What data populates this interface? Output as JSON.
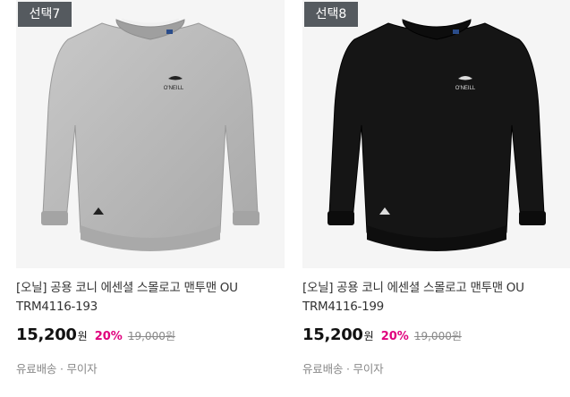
{
  "products": [
    {
      "badge": "선택7",
      "name_line1": "[오닐] 공용 코니 에센셜 스몰로고 맨투맨 OU",
      "name_line2": "TRM4116-193",
      "price": "15,200",
      "currency": "원",
      "discount": "20%",
      "original_price": "19,000원",
      "shipping": "유료배송 · 무이자",
      "color": "#b9b9b9",
      "logo_text": "O'NEILL"
    },
    {
      "badge": "선택8",
      "name_line1": "[오닐] 공용 코니 에센셜 스몰로고 맨투맨 OU",
      "name_line2": "TRM4116-199",
      "price": "15,200",
      "currency": "원",
      "discount": "20%",
      "original_price": "19,000원",
      "shipping": "유료배송 · 무이자",
      "color": "#141414",
      "logo_text": "O'NEILL"
    }
  ]
}
